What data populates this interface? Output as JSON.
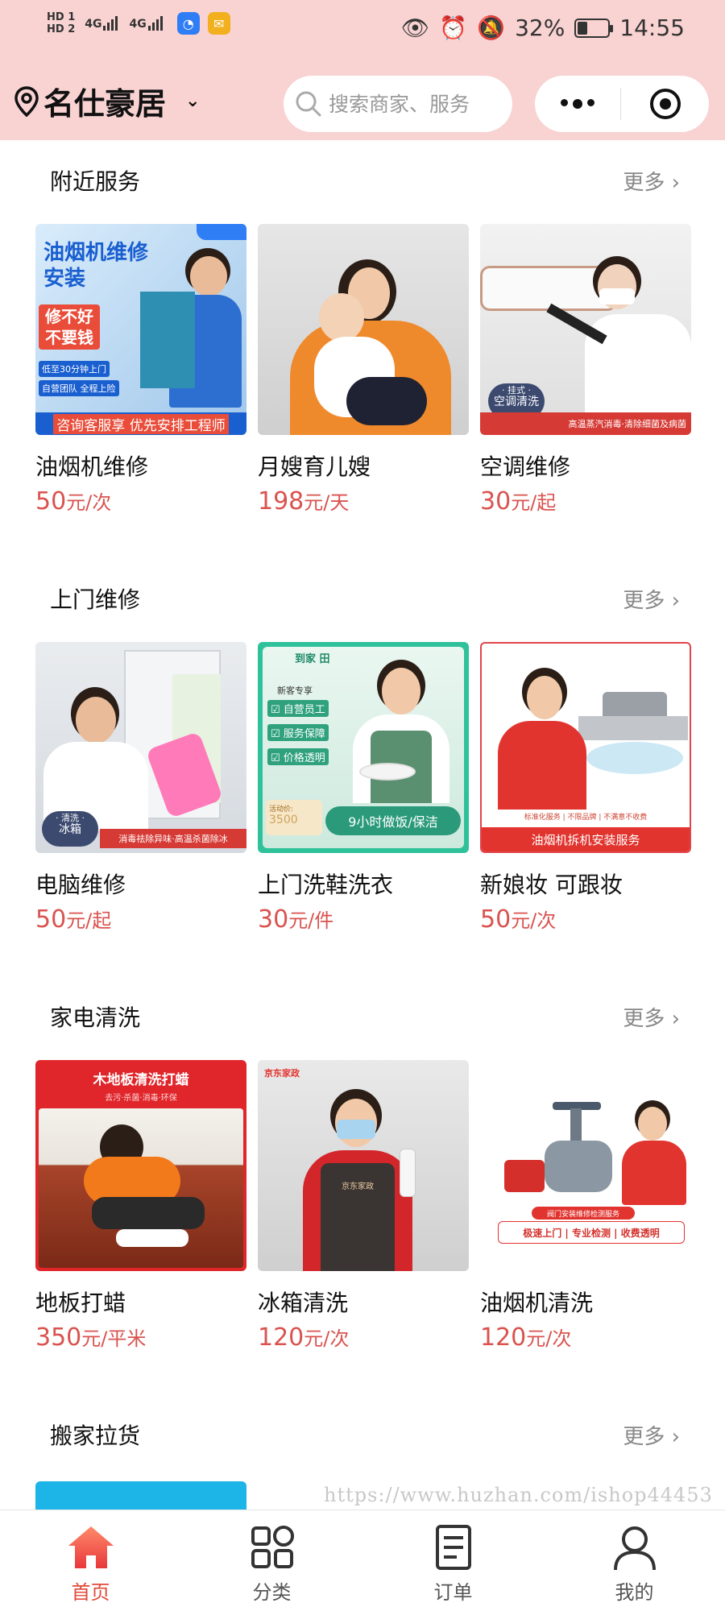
{
  "status_bar": {
    "sim1": "HD 1",
    "sim2": "HD 2",
    "net1": "4G",
    "net2": "4G",
    "battery": "32%",
    "battery_level": 0.32,
    "time": "14:55"
  },
  "header": {
    "location": "名仕豪居",
    "search_placeholder": "搜索商家、服务"
  },
  "sections": [
    {
      "title": "附近服务",
      "more": "更多",
      "items": [
        {
          "name": "油烟机维修",
          "price": "50",
          "unit": "元/次",
          "thumb": {
            "headline1": "油烟机维修",
            "headline2": "安装",
            "badge1": "修不好",
            "badge2": "不要钱",
            "line1": "低至30分钟上门",
            "line2": "自营团队 全程上险",
            "banner": "咨询客服享 优先安排工程师"
          }
        },
        {
          "name": "月嫂育儿嫂",
          "price": "198",
          "unit": "元/天"
        },
        {
          "name": "空调维修",
          "price": "30",
          "unit": "元/起",
          "thumb": {
            "tag_small": "· 挂式 ·",
            "tag": "空调清洗",
            "banner": "高温蒸汽消毒·清除细菌及病菌"
          }
        }
      ]
    },
    {
      "title": "上门维修",
      "more": "更多",
      "items": [
        {
          "name": "电脑维修",
          "price": "50",
          "unit": "元/起",
          "thumb": {
            "tag_small": "· 清洗 ·",
            "tag": "冰箱",
            "banner": "消毒祛除异味·高温杀菌除冰"
          }
        },
        {
          "name": "上门洗鞋洗衣",
          "price": "30",
          "unit": "元/件",
          "thumb": {
            "brand": "到家 田",
            "new": "新客专享",
            "check1": "自营员工",
            "check2": "服务保障",
            "check3": "价格透明",
            "price_label": "活动价:",
            "price_value": "3500",
            "banner": "9小时做饭/保洁"
          }
        },
        {
          "name": "新娘妆 可跟妆",
          "price": "50",
          "unit": "元/次",
          "thumb": {
            "chips": "标准化服务 | 不限品牌 | 不满意不收费",
            "banner": "油烟机拆机安装服务"
          }
        }
      ]
    },
    {
      "title": "家电清洗",
      "more": "更多",
      "items": [
        {
          "name": "地板打蜡",
          "price": "350",
          "unit": "元/平米",
          "thumb": {
            "headline": "木地板清洗打蜡",
            "sub": "去污·杀菌·消毒·环保"
          }
        },
        {
          "name": "冰箱清洗",
          "price": "120",
          "unit": "元/次",
          "thumb": {
            "brand": "京东家政",
            "apron": "京东家政"
          }
        },
        {
          "name": "油烟机清洗",
          "price": "120",
          "unit": "元/次",
          "thumb": {
            "title": "阀门安装维修检测服务",
            "slogan": "极速上门 | 专业检测 | 收费透明"
          }
        }
      ]
    },
    {
      "title": "搬家拉货",
      "more": "更多",
      "items": []
    }
  ],
  "watermark": "https://www.huzhan.com/ishop44453",
  "tabbar": [
    {
      "label": "首页",
      "icon": "home-icon",
      "active": true
    },
    {
      "label": "分类",
      "icon": "grid-icon",
      "active": false
    },
    {
      "label": "订单",
      "icon": "order-icon",
      "active": false
    },
    {
      "label": "我的",
      "icon": "user-icon",
      "active": false
    }
  ],
  "colors": {
    "accent": "#e24a3b",
    "price": "#d9534f",
    "header_bg": "#f9d2d2"
  }
}
